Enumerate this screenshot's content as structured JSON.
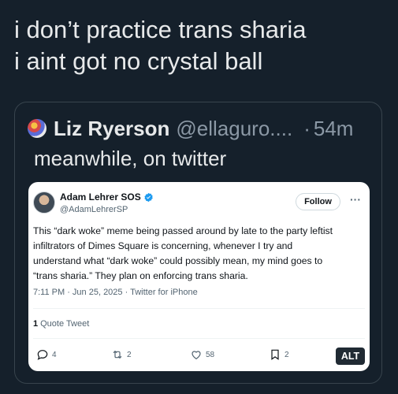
{
  "post": {
    "lines": [
      "i don’t practice trans sharia",
      "i aint got no crystal ball"
    ]
  },
  "quote": {
    "name": "Liz Ryerson",
    "handle": "@ellaguro....",
    "separator": "·",
    "time": "54m",
    "text": "meanwhile, on twitter"
  },
  "embedded_tweet": {
    "name": "Adam Lehrer SOS",
    "handle": "@AdamLehrerSP",
    "follow_label": "Follow",
    "more_label": "···",
    "body_lines": [
      "This “dark woke” meme being passed around by late to the party leftist",
      "infiltrators of Dimes Square is concerning, whenever I try and",
      "understand what “dark woke” could possibly mean, my mind goes to",
      "“trans sharia.” They plan on enforcing trans sharia."
    ],
    "meta": "7:11 PM · Jun 25, 2025 · Twitter for iPhone",
    "quote_count": "1",
    "quote_label": "Quote Tweet",
    "actions": {
      "replies": "4",
      "retweets": "2",
      "likes": "58",
      "bookmarks": "2"
    },
    "alt_label": "ALT",
    "colors": {
      "verified": "#1d9bf0"
    }
  }
}
